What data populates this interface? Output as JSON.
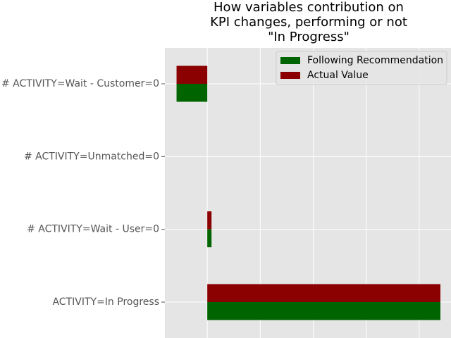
{
  "chart_data": {
    "type": "bar",
    "orientation": "horizontal",
    "title": "How variables contribution on KPI changes, performing or not \"In Progress\"",
    "title_lines": [
      "How variables contribution on",
      "KPI changes, performing or not",
      "\"In Progress\""
    ],
    "categories": [
      "# ACTIVITY=Wait - Customer=0",
      "# ACTIVITY=Unmatched=0",
      "# ACTIVITY=Wait - User=0",
      "ACTIVITY=In Progress"
    ],
    "series": [
      {
        "name": "Following Recommendation",
        "values": [
          -0.29,
          0.0,
          0.04,
          2.2
        ],
        "color": "#006400"
      },
      {
        "name": "Actual Value",
        "values": [
          -0.29,
          0.0,
          0.04,
          2.2
        ],
        "color": "#8b0000"
      }
    ],
    "xlim": [
      -0.4,
      2.3
    ],
    "xlabel": "",
    "ylabel": "",
    "grid": true,
    "background": "#e5e5e5",
    "gridline_color": "#ffffff",
    "legend_position": "top-right"
  }
}
